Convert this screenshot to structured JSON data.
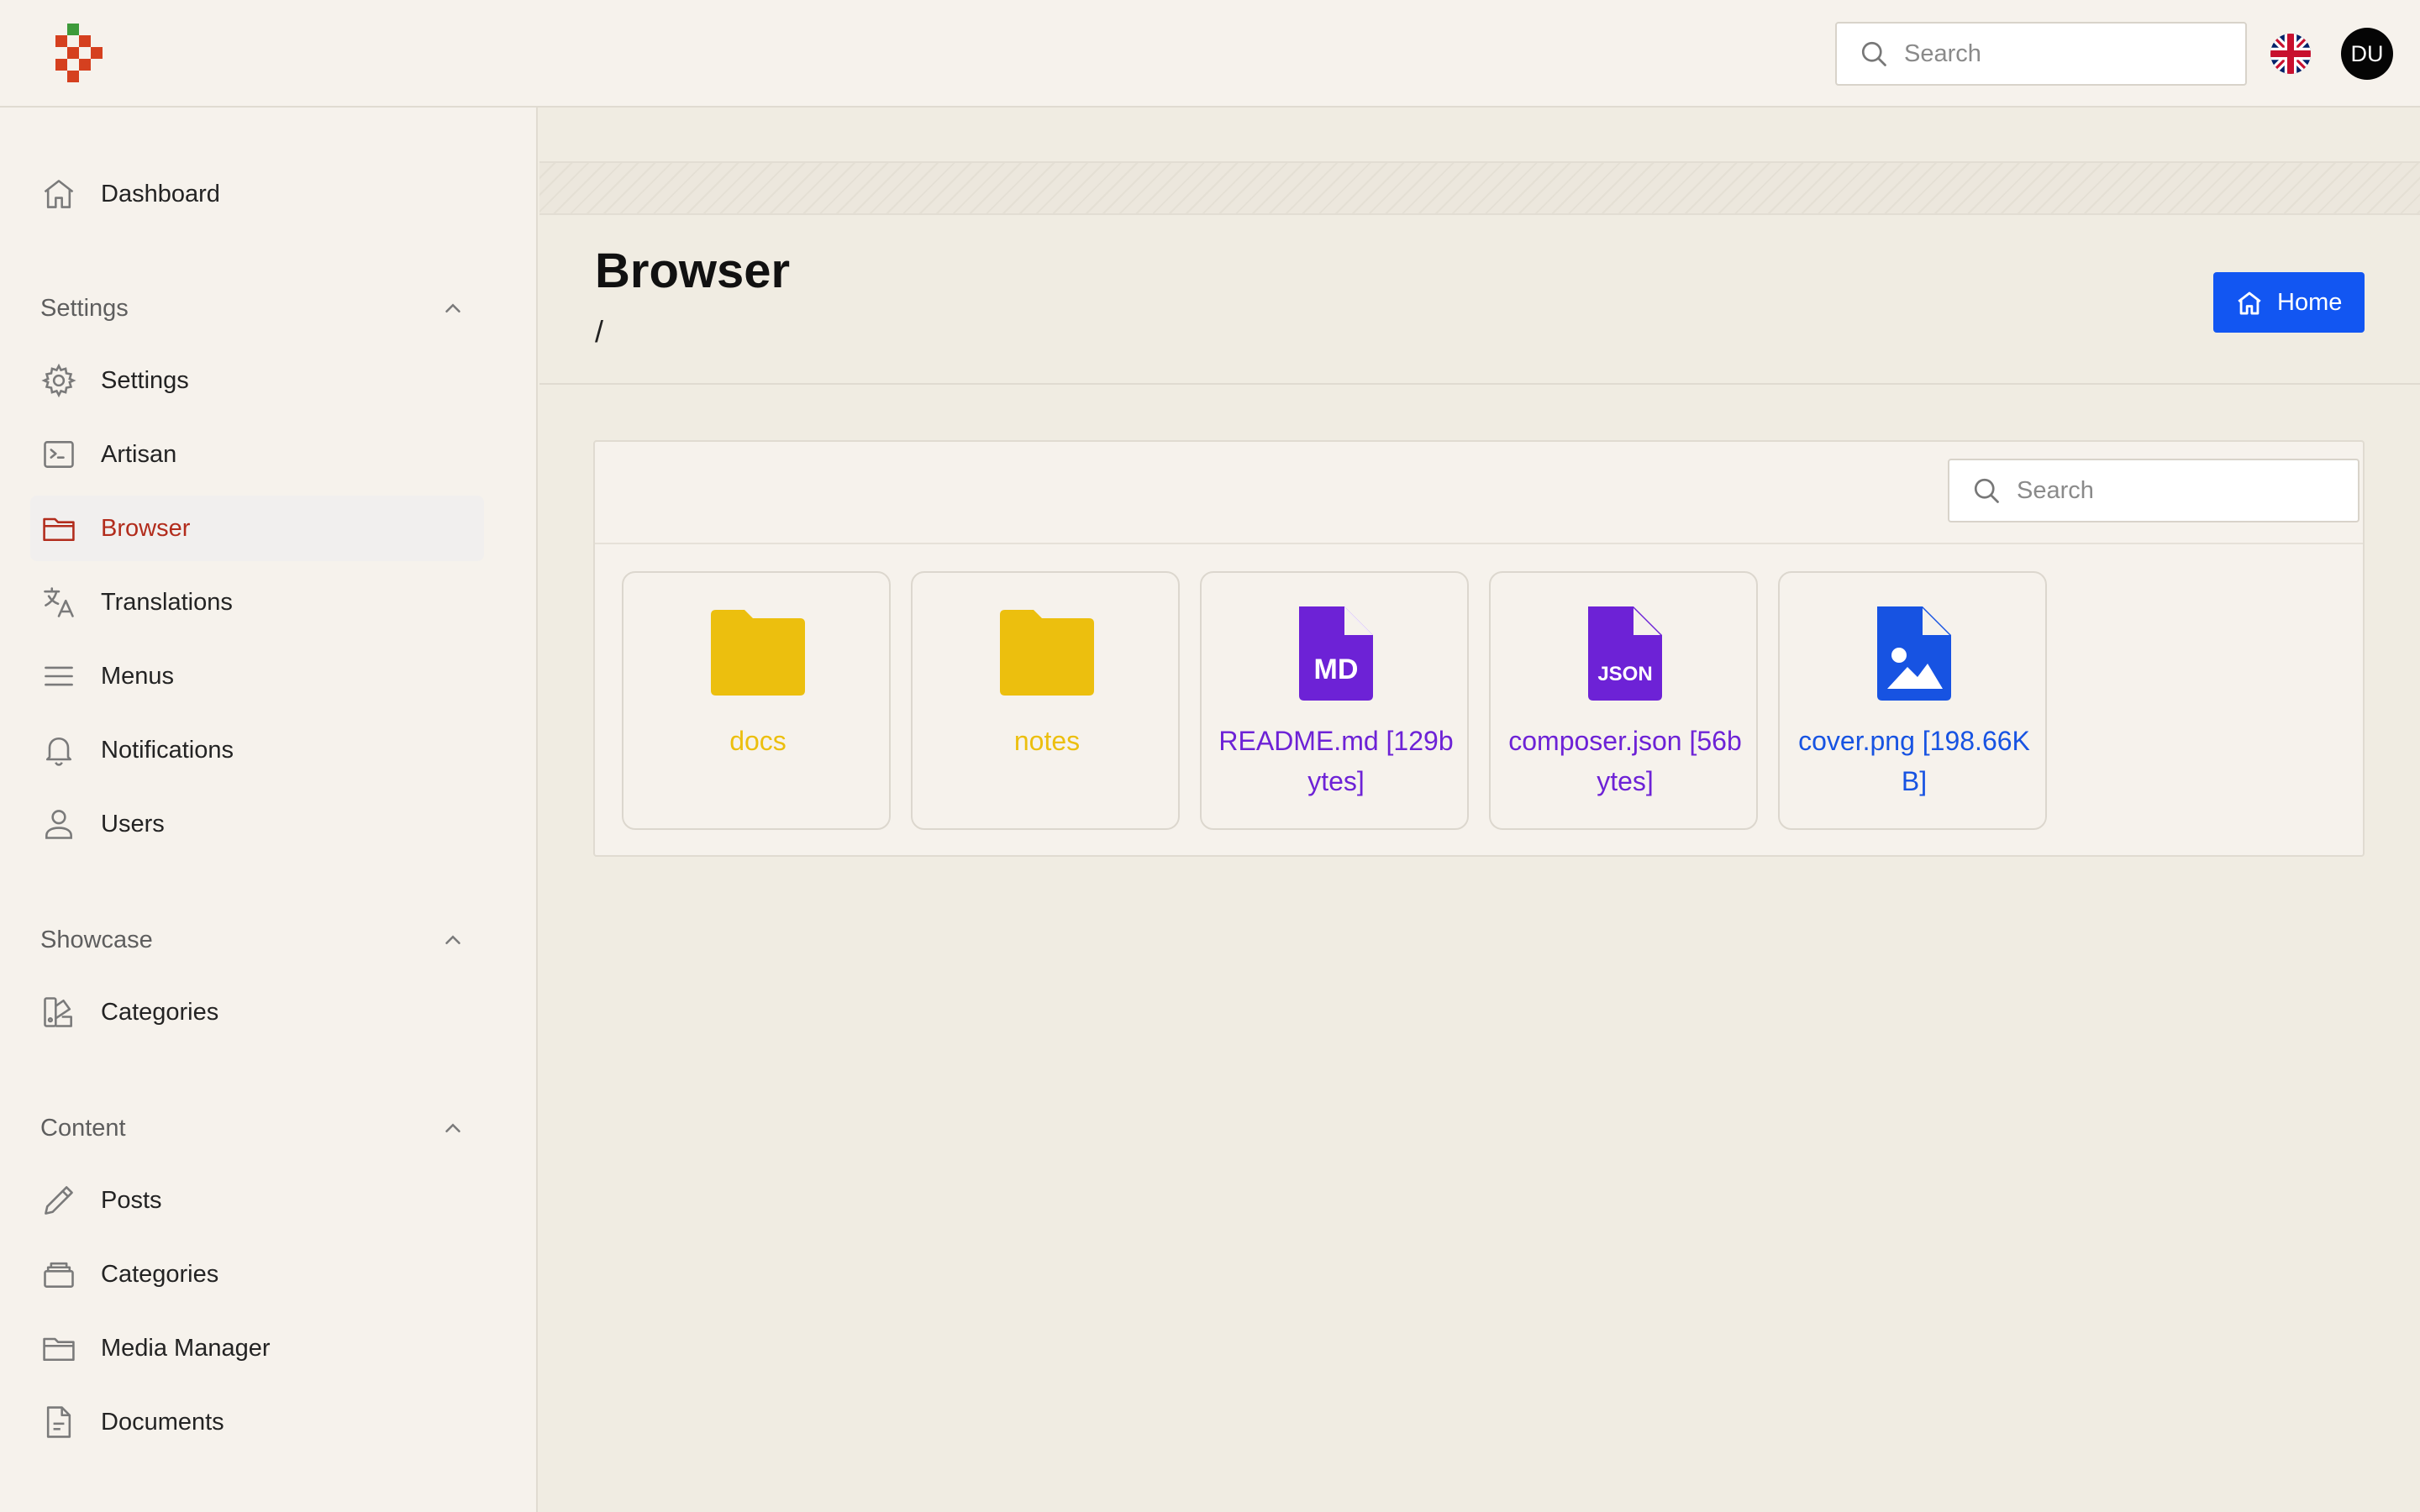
{
  "header": {
    "search_placeholder": "Search",
    "avatar_initials": "DU"
  },
  "sidebar": {
    "dashboard": {
      "label": "Dashboard"
    },
    "sections": [
      {
        "title": "Settings",
        "items": [
          {
            "label": "Settings",
            "icon": "gear-icon"
          },
          {
            "label": "Artisan",
            "icon": "terminal-icon"
          },
          {
            "label": "Browser",
            "icon": "folder-icon",
            "active": true
          },
          {
            "label": "Translations",
            "icon": "translate-icon"
          },
          {
            "label": "Menus",
            "icon": "menu-icon"
          },
          {
            "label": "Notifications",
            "icon": "bell-icon"
          },
          {
            "label": "Users",
            "icon": "user-icon"
          }
        ]
      },
      {
        "title": "Showcase",
        "items": [
          {
            "label": "Categories",
            "icon": "swatch-icon"
          }
        ]
      },
      {
        "title": "Content",
        "items": [
          {
            "label": "Posts",
            "icon": "pencil-icon"
          },
          {
            "label": "Categories",
            "icon": "stack-icon"
          },
          {
            "label": "Media Manager",
            "icon": "folder-icon"
          },
          {
            "label": "Documents",
            "icon": "document-icon"
          }
        ]
      }
    ]
  },
  "page": {
    "title": "Browser",
    "breadcrumb": "/",
    "home_button": "Home"
  },
  "browser": {
    "search_placeholder": "Search",
    "items": [
      {
        "label": "docs",
        "type": "folder",
        "color": "#ecbf0e"
      },
      {
        "label": "notes",
        "type": "folder",
        "color": "#ecbf0e"
      },
      {
        "label": "README.md [129bytes]",
        "type": "markdown",
        "badge": "MD",
        "color": "#6d22d6"
      },
      {
        "label": "composer.json [56bytes]",
        "type": "json",
        "badge": "JSON",
        "color": "#6d22d6"
      },
      {
        "label": "cover.png [198.66KB]",
        "type": "image",
        "color": "#1753e2"
      }
    ]
  },
  "colors": {
    "accent": "#1256f2",
    "active_nav": "#b22c1c",
    "folder": "#ecbf0e",
    "code_file": "#6d22d6",
    "image_file": "#1753e2"
  }
}
